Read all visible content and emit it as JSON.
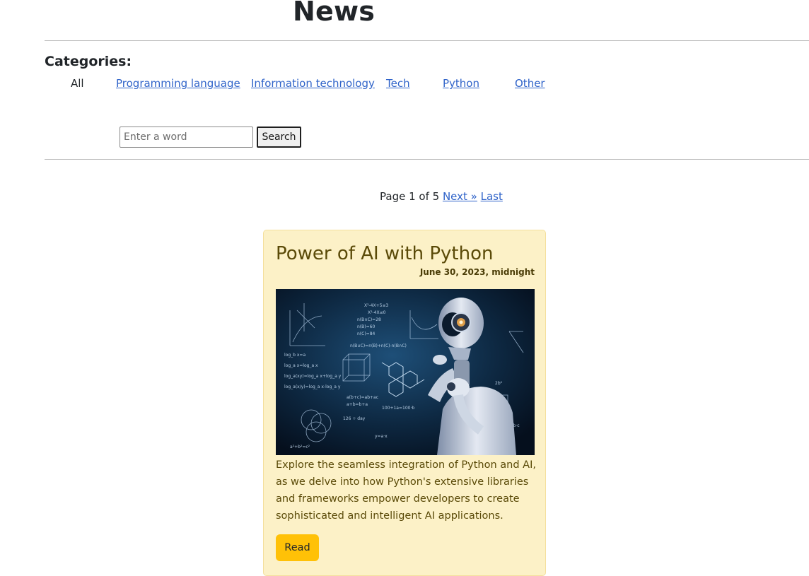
{
  "header": {
    "title": "News"
  },
  "categories": {
    "heading": "Categories:",
    "items": [
      {
        "label": "All"
      },
      {
        "label": "Programming language"
      },
      {
        "label": "Information technology"
      },
      {
        "label": "Tech"
      },
      {
        "label": "Python"
      },
      {
        "label": "Other"
      }
    ]
  },
  "search": {
    "placeholder": "Enter a word",
    "value": "",
    "button_label": "Search"
  },
  "pagination": {
    "status": "Page 1 of 5",
    "next_label": "Next »",
    "last_label": "Last"
  },
  "posts": [
    {
      "title": "Power of AI with Python",
      "date": "June 30, 2023, midnight",
      "image_alt": "robot-thinking-with-formulas",
      "excerpt": "Explore the seamless integration of Python and AI, as we delve into how Python's extensive libraries and frameworks empower developers to create sophisticated and intelligent AI applications.",
      "read_label": "Read"
    }
  ],
  "colors": {
    "link": "#2f63c9",
    "card_bg": "#fcf1c7",
    "card_text": "#5a4a08",
    "button_accent": "#ffc107"
  }
}
